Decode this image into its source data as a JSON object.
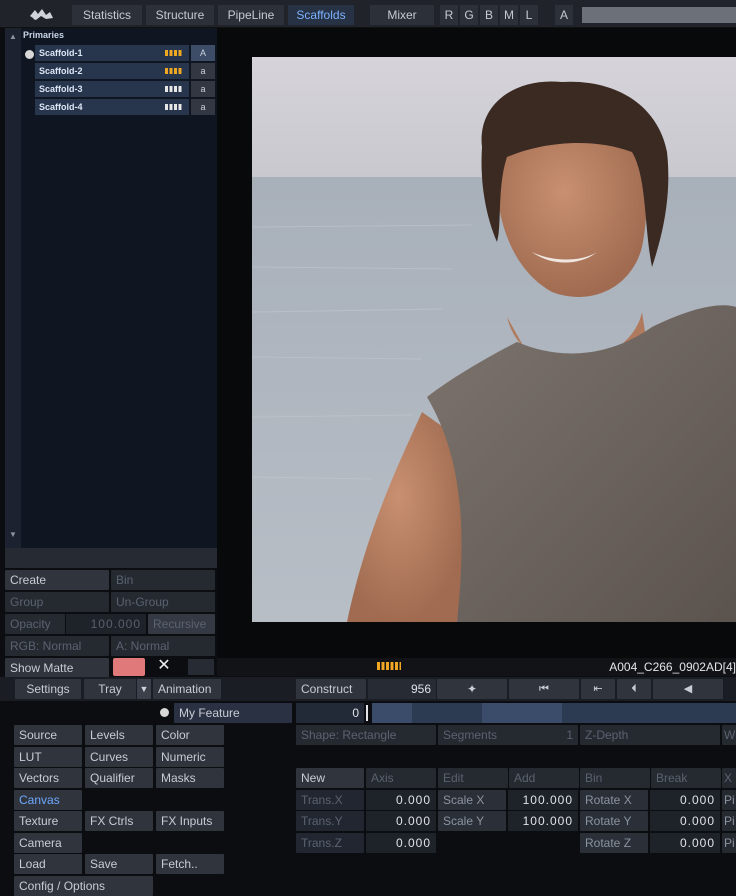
{
  "topbar": {
    "tabs": [
      "Statistics",
      "Structure",
      "PipeLine",
      "Scaffolds",
      "Mixer"
    ],
    "active_tab": "Scaffolds",
    "channels": [
      "R",
      "G",
      "B",
      "M",
      "L",
      "A"
    ]
  },
  "scaffold_panel": {
    "header": "Primaries",
    "items": [
      {
        "name": "Scaffold-1",
        "mode": "A",
        "active": true
      },
      {
        "name": "Scaffold-2",
        "mode": "a",
        "active": false
      },
      {
        "name": "Scaffold-3",
        "mode": "a",
        "active": false
      },
      {
        "name": "Scaffold-4",
        "mode": "a",
        "active": false
      }
    ]
  },
  "left_controls": {
    "create": "Create",
    "bin": "Bin",
    "group": "Group",
    "ungroup": "Un-Group",
    "opacity_label": "Opacity",
    "opacity_value": "100.000",
    "recursive": "Recursive",
    "rgb_mode": "RGB: Normal",
    "alpha_mode": "A: Normal",
    "show_matte": "Show Matte",
    "close": "✕",
    "matte_color": "#e07a7a"
  },
  "timeline": {
    "clip_name": "A004_C266_0902AD[4]",
    "frame": "956",
    "position": "0"
  },
  "toolbar": {
    "settings": "Settings",
    "tray": "Tray",
    "animation": "Animation",
    "construct": "Construct",
    "feature": "My Feature"
  },
  "menu_grid": {
    "col1": [
      "Source",
      "LUT",
      "Vectors",
      "Canvas",
      "Texture",
      "Camera",
      "Load",
      "Config / Options"
    ],
    "col2": [
      "Levels",
      "Curves",
      "Qualifier",
      "",
      "FX Ctrls",
      "",
      "Save"
    ],
    "col3": [
      "Color",
      "Numeric",
      "Masks",
      "",
      "FX Inputs",
      "",
      "Fetch.."
    ]
  },
  "shape_panel": {
    "shape": "Shape: Rectangle",
    "segments_label": "Segments",
    "segments_value": "1",
    "zdepth": "Z-Depth",
    "wrap": "W",
    "tools": [
      "New",
      "Axis",
      "Edit",
      "Add",
      "Bin",
      "Break",
      "X"
    ],
    "params": [
      {
        "label": "Trans.X",
        "value": "0.000"
      },
      {
        "label": "Trans.Y",
        "value": "0.000"
      },
      {
        "label": "Trans.Z",
        "value": "0.000"
      },
      {
        "label": "Scale X",
        "value": "100.000"
      },
      {
        "label": "Scale Y",
        "value": "100.000"
      },
      {
        "label": "Rotate X",
        "value": "0.000"
      },
      {
        "label": "Rotate Y",
        "value": "0.000"
      },
      {
        "label": "Rotate Z",
        "value": "0.000"
      }
    ],
    "overflow": [
      "Pi",
      "Pi",
      "Pi"
    ]
  }
}
